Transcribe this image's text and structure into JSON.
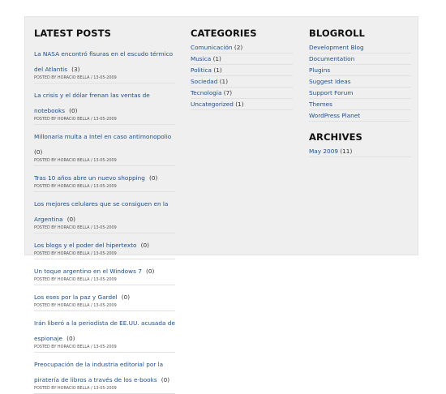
{
  "latest_posts": {
    "title": "LATEST POSTS",
    "items": [
      {
        "title": "La NASA encontró fisuras en el escudo térmico del Atlantis",
        "count": "(3)",
        "meta": "POSTED BY HORACIO BELLA / 13-05-2009"
      },
      {
        "title": "La crisis y el dólar frenan las ventas de notebooks",
        "count": "(0)",
        "meta": "POSTED BY HORACIO BELLA / 13-05-2009"
      },
      {
        "title": "Millonaria multa a Intel en caso antimonopolio",
        "count": "(0)",
        "meta": "POSTED BY HORACIO BELLA / 13-05-2009"
      },
      {
        "title": "Tras 10 años abre un nuevo shopping",
        "count": "(0)",
        "meta": "POSTED BY HORACIO BELLA / 13-05-2009"
      },
      {
        "title": "Los mejores celulares que se consiguen en la Argentina",
        "count": "(0)",
        "meta": "POSTED BY HORACIO BELLA / 13-05-2009"
      },
      {
        "title": "Los blogs y el poder del hipertexto",
        "count": "(0)",
        "meta": "POSTED BY HORACIO BELLA / 13-05-2009"
      },
      {
        "title": "Un toque argentino en el Windows 7",
        "count": "(0)",
        "meta": "POSTED BY HORACIO BELLA / 13-05-2009"
      },
      {
        "title": "Los eses por la paz y Gardel",
        "count": "(0)",
        "meta": "POSTED BY HORACIO BELLA / 13-05-2009"
      },
      {
        "title": "Irán liberó a la periodista de EE.UU. acusada de espionaje",
        "count": "(0)",
        "meta": "POSTED BY HORACIO BELLA / 13-05-2009"
      },
      {
        "title": "Preocupación de la industria editorial por la piratería de libros a través de los e-books",
        "count": "(0)",
        "meta": "POSTED BY HORACIO BELLA / 13-05-2009"
      }
    ]
  },
  "categories": {
    "title": "CATEGORIES",
    "items": [
      {
        "label": "Comunicación",
        "count": "(2)"
      },
      {
        "label": "Musica",
        "count": "(1)"
      },
      {
        "label": "Politica",
        "count": "(1)"
      },
      {
        "label": "Sociedad",
        "count": "(1)"
      },
      {
        "label": "Tecnologia",
        "count": "(7)"
      },
      {
        "label": "Uncategorized",
        "count": "(1)"
      }
    ]
  },
  "blogroll": {
    "title": "BLOGROLL",
    "items": [
      {
        "label": "Development Blog"
      },
      {
        "label": "Documentation"
      },
      {
        "label": "Plugins"
      },
      {
        "label": "Suggest Ideas"
      },
      {
        "label": "Support Forum"
      },
      {
        "label": "Themes"
      },
      {
        "label": "WordPress Planet"
      }
    ]
  },
  "archives": {
    "title": "ARCHIVES",
    "items": [
      {
        "label": "May 2009",
        "count": "(11)"
      }
    ]
  }
}
